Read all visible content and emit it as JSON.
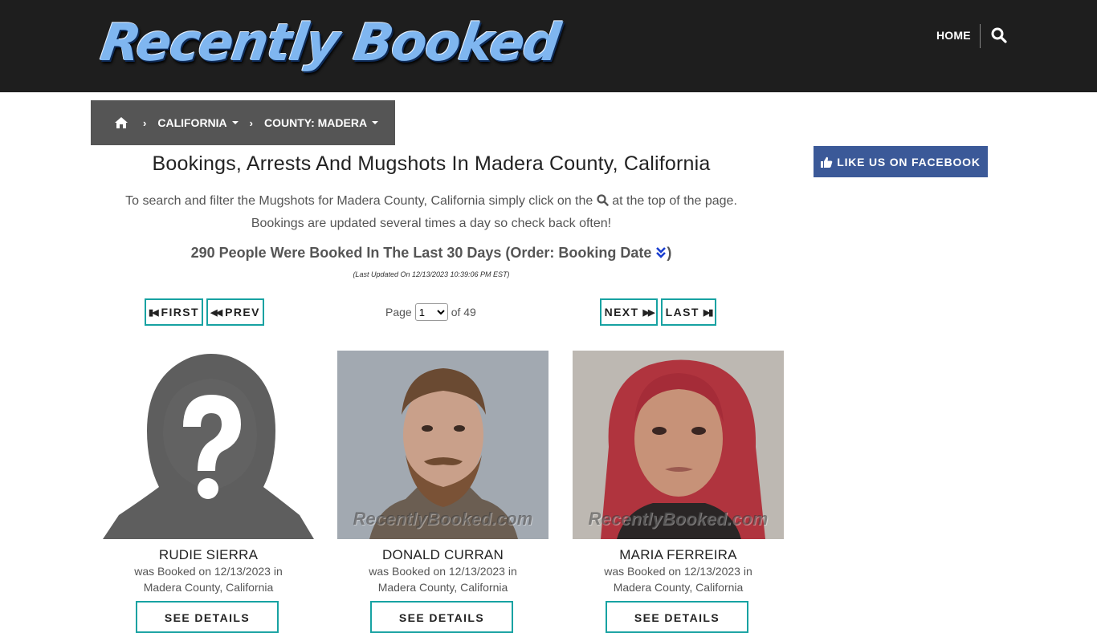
{
  "header": {
    "logo_text": "Recently Booked",
    "nav_home": "HOME",
    "search_icon": "search-icon"
  },
  "breadcrumb": {
    "home_icon": "home-icon",
    "state": "CALIFORNIA",
    "county": "COUNTY: MADERA"
  },
  "facebook": {
    "label": "LIKE US ON FACEBOOK",
    "color": "#3b5998"
  },
  "main": {
    "title": "Bookings, Arrests And Mugshots In Madera County, California",
    "intro_part1": "To search and filter the Mugshots for Madera County, California simply click on the",
    "intro_part2": "at the top of the page.",
    "intro_line2": "Bookings are updated several times a day so check back often!",
    "count_text": "290 People Were Booked In The Last 30 Days (Order: Booking Date",
    "count_close": ")",
    "last_updated": "(Last Updated On 12/13/2023 10:39:06 PM EST)"
  },
  "pagination": {
    "first": "FIRST",
    "prev": "PREV",
    "next": "NEXT",
    "last": "LAST",
    "page_label": "Page",
    "current_page": "1",
    "of_label": "of 49",
    "accent": "#17a2a2"
  },
  "cards": [
    {
      "name": "RUDIE SIERRA",
      "line1": "was Booked on 12/13/2023 in",
      "line2": "Madera County, California",
      "details": "SEE DETAILS",
      "watermark": ""
    },
    {
      "name": "DONALD CURRAN",
      "line1": "was Booked on 12/13/2023 in",
      "line2": "Madera County, California",
      "details": "SEE DETAILS",
      "watermark": "RecentlyBooked.com"
    },
    {
      "name": "MARIA FERREIRA",
      "line1": "was Booked on 12/13/2023 in",
      "line2": "Madera County, California",
      "details": "SEE DETAILS",
      "watermark": "RecentlyBooked.com"
    }
  ]
}
